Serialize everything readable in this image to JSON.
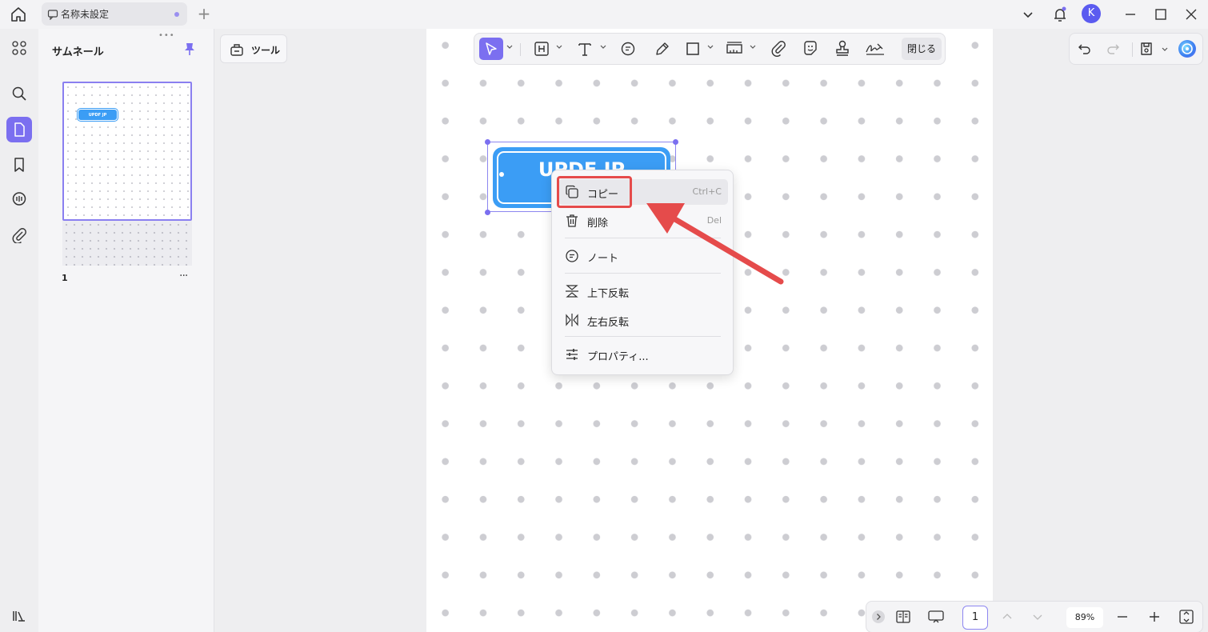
{
  "tab": {
    "title": "名称未設定"
  },
  "sidebar": {
    "panel_title": "サムネール"
  },
  "thumbnail": {
    "page_number": "1",
    "more": "···",
    "badge_text": "UPDF JP"
  },
  "tools": {
    "label": "ツール"
  },
  "annotation_toolbar": {
    "close_label": "閉じる"
  },
  "canvas": {
    "stamp_text": "UPDF JP"
  },
  "context_menu": {
    "items": [
      {
        "label": "コピー",
        "shortcut": "Ctrl+C"
      },
      {
        "label": "削除",
        "shortcut": "Del"
      },
      {
        "label": "ノート",
        "shortcut": ""
      },
      {
        "label": "上下反転",
        "shortcut": ""
      },
      {
        "label": "左右反転",
        "shortcut": ""
      },
      {
        "label": "プロパティ...",
        "shortcut": ""
      }
    ]
  },
  "user": {
    "avatar_initial": "K"
  },
  "bottom_bar": {
    "page": "1",
    "zoom": "89%"
  },
  "colors": {
    "accent": "#7b6ff0",
    "stamp_blue": "#3b9df5",
    "highlight_red": "#e54b4b"
  }
}
